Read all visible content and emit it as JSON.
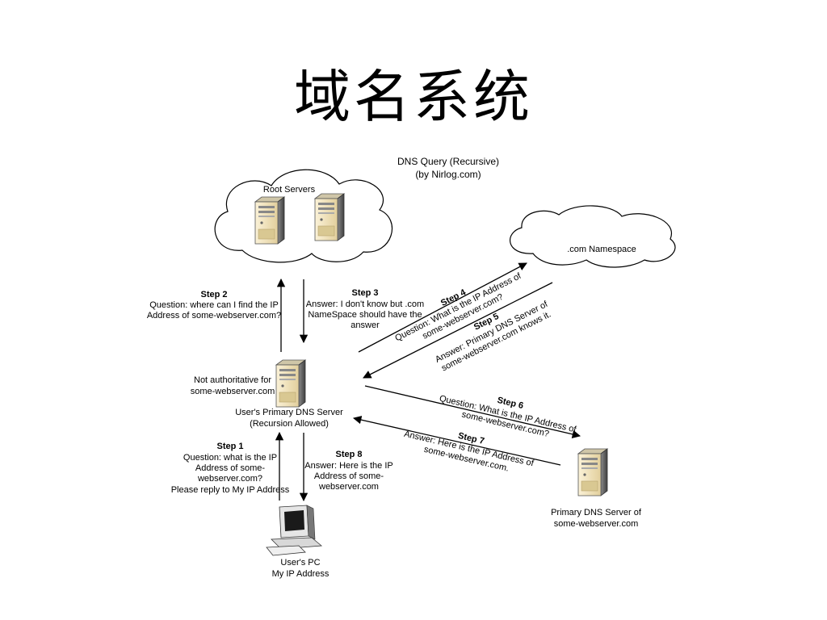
{
  "slide": {
    "title": "域名系统"
  },
  "diagram": {
    "header": [
      "DNS Query (Recursive)",
      "(by Nirlog.com)"
    ],
    "root_servers": "Root Servers",
    "com_namespace": ".com Namespace",
    "primary_dns": [
      "User's Primary DNS Server",
      "(Recursion Allowed)"
    ],
    "not_authoritative": [
      "Not authoritative for",
      "some-webserver.com"
    ],
    "authoritative_dns": [
      "Primary DNS Server of",
      "some-webserver.com"
    ],
    "users_pc": [
      "User's PC",
      "My IP Address"
    ],
    "steps": [
      {
        "title": "Step 1",
        "lines": [
          "Question: what is the IP",
          "Address of some-",
          "webserver.com?",
          "Please reply to My IP Address"
        ]
      },
      {
        "title": "Step 2",
        "lines": [
          "Question: where can I find the IP",
          "Address of some-webserver.com?"
        ]
      },
      {
        "title": "Step 3",
        "lines": [
          "Answer: I don't know but .com",
          "NameSpace should have the",
          "answer"
        ]
      },
      {
        "title": "Step 4",
        "lines": [
          "Question: What is the IP Address of",
          "some-webserver.com?"
        ]
      },
      {
        "title": "Step 5",
        "lines": [
          "Answer: Primary DNS Server of",
          "some-webserver.com knows it."
        ]
      },
      {
        "title": "Step 6",
        "lines": [
          "Question: What is the IP Address of",
          "some-webserver.com?"
        ]
      },
      {
        "title": "Step 7",
        "lines": [
          "Answer: Here is the IP Address of",
          "some-webserver.com."
        ]
      },
      {
        "title": "Step 8",
        "lines": [
          "Answer: Here is the IP",
          "Address of some-",
          "webserver.com"
        ]
      }
    ]
  }
}
